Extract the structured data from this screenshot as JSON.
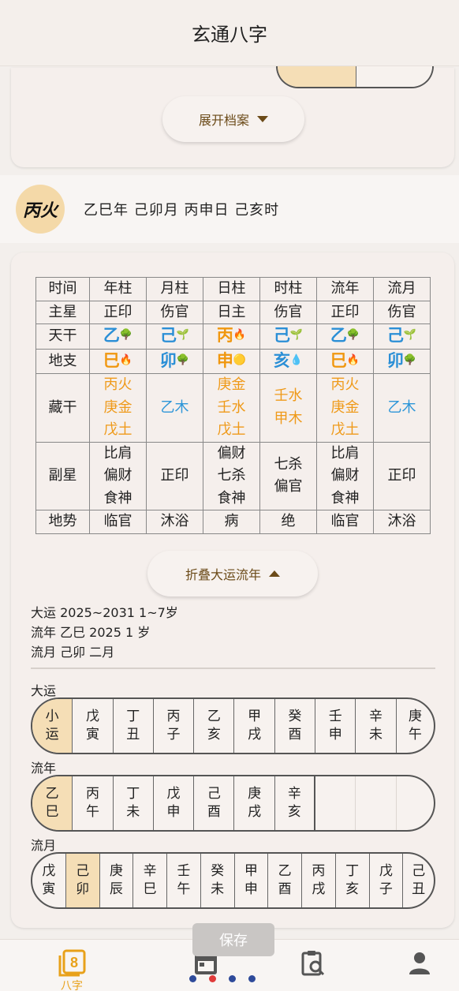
{
  "header": {
    "title": "玄通八字"
  },
  "profile": {
    "expand_label": "展开档案"
  },
  "summary": {
    "day_master": "丙火",
    "pillars_text": "乙巳年 己卯月 丙申日 己亥时"
  },
  "chart": {
    "headers": [
      "时间",
      "年柱",
      "月柱",
      "日柱",
      "时柱",
      "流年",
      "流月"
    ],
    "main_star": {
      "label": "主星",
      "values": [
        "正印",
        "伤官",
        "日主",
        "伤官",
        "正印",
        "伤官"
      ]
    },
    "stems": {
      "label": "天干",
      "values": [
        "乙",
        "己",
        "丙",
        "己",
        "乙",
        "己"
      ],
      "icons": [
        "tree-icon",
        "sprout-icon",
        "fire-icon",
        "sprout-icon",
        "tree-icon",
        "sprout-icon"
      ]
    },
    "branches": {
      "label": "地支",
      "values": [
        "巳",
        "卯",
        "申",
        "亥",
        "巳",
        "卯"
      ],
      "icons": [
        "fire-icon",
        "tree-icon",
        "gold-coin-icon",
        "water-drop-icon",
        "fire-icon",
        "tree-icon"
      ]
    },
    "hidden": {
      "label": "藏干",
      "values": [
        [
          "丙火",
          "庚金",
          "戊土"
        ],
        [
          "乙木"
        ],
        [
          "庚金",
          "壬水",
          "戊土"
        ],
        [
          "壬水",
          "甲木"
        ],
        [
          "丙火",
          "庚金",
          "戊土"
        ],
        [
          "乙木"
        ]
      ]
    },
    "sub_star": {
      "label": "副星",
      "values": [
        [
          "比肩",
          "偏财",
          "食神"
        ],
        [
          "正印"
        ],
        [
          "偏财",
          "七杀",
          "食神"
        ],
        [
          "七杀",
          "偏官"
        ],
        [
          "比肩",
          "偏财",
          "食神"
        ],
        [
          "正印"
        ]
      ]
    },
    "terrain": {
      "label": "地势",
      "values": [
        "临官",
        "沐浴",
        "病",
        "绝",
        "临官",
        "沐浴"
      ]
    },
    "colors": {
      "fire": "#f0970f",
      "wood": "#2b8fd6",
      "metal": "#f0970f",
      "water": "#2b8fd6"
    }
  },
  "fortune": {
    "fold_label": "折叠大运流年",
    "current_dayun": "大运  2025~2031 1~7岁",
    "current_liunian": "流年 乙巳 2025 1 岁",
    "current_liuyue": "流月 己卯 二月",
    "dayun_label": "大运",
    "dayun": [
      [
        "小",
        "运"
      ],
      [
        "戊",
        "寅"
      ],
      [
        "丁",
        "丑"
      ],
      [
        "丙",
        "子"
      ],
      [
        "乙",
        "亥"
      ],
      [
        "甲",
        "戌"
      ],
      [
        "癸",
        "酉"
      ],
      [
        "壬",
        "申"
      ],
      [
        "辛",
        "未"
      ],
      [
        "庚",
        "午"
      ]
    ],
    "liunian_label": "流年",
    "liunian": [
      [
        "乙",
        "巳"
      ],
      [
        "丙",
        "午"
      ],
      [
        "丁",
        "未"
      ],
      [
        "戊",
        "申"
      ],
      [
        "己",
        "酉"
      ],
      [
        "庚",
        "戌"
      ],
      [
        "辛",
        "亥"
      ],
      [
        "",
        ""
      ],
      [
        "",
        ""
      ],
      [
        "",
        ""
      ]
    ],
    "liuyue_label": "流月",
    "liuyue": [
      [
        "戊",
        "寅"
      ],
      [
        "己",
        "卯"
      ],
      [
        "庚",
        "辰"
      ],
      [
        "辛",
        "巳"
      ],
      [
        "壬",
        "午"
      ],
      [
        "癸",
        "未"
      ],
      [
        "甲",
        "申"
      ],
      [
        "乙",
        "酉"
      ],
      [
        "丙",
        "戌"
      ],
      [
        "丁",
        "亥"
      ],
      [
        "戊",
        "子"
      ],
      [
        "己",
        "丑"
      ]
    ]
  },
  "save_label": "保存",
  "tabbar": {
    "bazi_label": "八字",
    "bazi_icon": "eight-icon",
    "calendar_icon": "calendar-icon",
    "search_icon": "clipboard-search-icon",
    "user_icon": "user-icon"
  }
}
